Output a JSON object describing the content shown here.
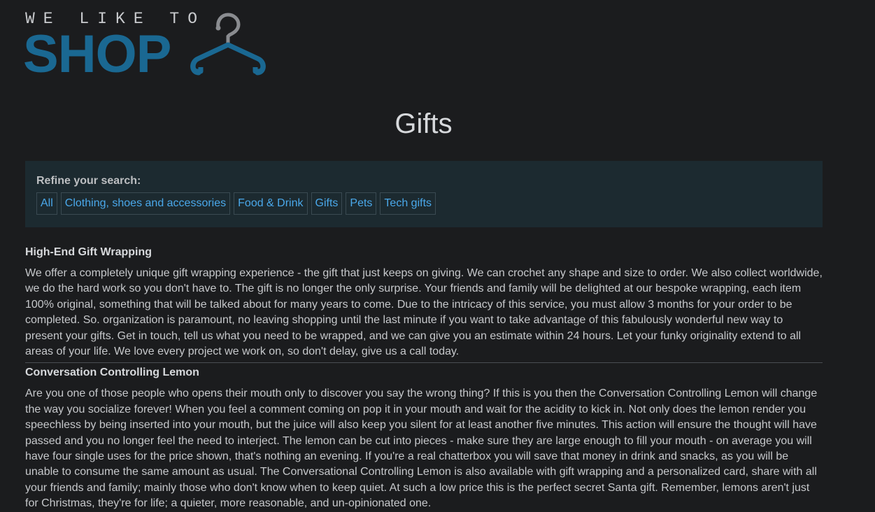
{
  "logo": {
    "top_text": "WE LIKE TO",
    "main_text": "SHOP",
    "icon": "hanger-icon",
    "colors": {
      "main": "#1a6892",
      "hanger": "#1a6892",
      "hook": "#8a8c90"
    }
  },
  "page": {
    "title": "Gifts"
  },
  "filter": {
    "label": "Refine your search:",
    "categories": [
      "All",
      "Clothing, shoes and accessories",
      "Food & Drink",
      "Gifts",
      "Pets",
      "Tech gifts"
    ]
  },
  "products": [
    {
      "title": "High-End Gift Wrapping",
      "description": "We offer a completely unique gift wrapping experience - the gift that just keeps on giving. We can crochet any shape and size to order. We also collect worldwide, we do the hard work so you don't have to. The gift is no longer the only surprise. Your friends and family will be delighted at our bespoke wrapping, each item 100% original, something that will be talked about for many years to come. Due to the intricacy of this service, you must allow 3 months for your order to be completed. So. organization is paramount, no leaving shopping until the last minute if you want to take advantage of this fabulously wonderful new way to present your gifts. Get in touch, tell us what you need to be wrapped, and we can give you an estimate within 24 hours. Let your funky originality extend to all areas of your life. We love every project we work on, so don't delay, give us a call today."
    },
    {
      "title": "Conversation Controlling Lemon",
      "description": "Are you one of those people who opens their mouth only to discover you say the wrong thing? If this is you then the Conversation Controlling Lemon will change the way you socialize forever! When you feel a comment coming on pop it in your mouth and wait for the acidity to kick in. Not only does the lemon render you speechless by being inserted into your mouth, but the juice will also keep you silent for at least another five minutes. This action will ensure the thought will have passed and you no longer feel the need to interject. The lemon can be cut into pieces - make sure they are large enough to fill your mouth - on average you will have four single uses for the price shown, that's nothing an evening. If you're a real chatterbox you will save that money in drink and snacks, as you will be unable to consume the same amount as usual. The Conversational Controlling Lemon is also available with gift wrapping and a personalized card, share with all your friends and family; mainly those who don't know when to keep quiet. At such a low price this is the perfect secret Santa gift. Remember, lemons aren't just for Christmas, they're for life; a quieter, more reasonable, and un-opinionated one."
    }
  ]
}
